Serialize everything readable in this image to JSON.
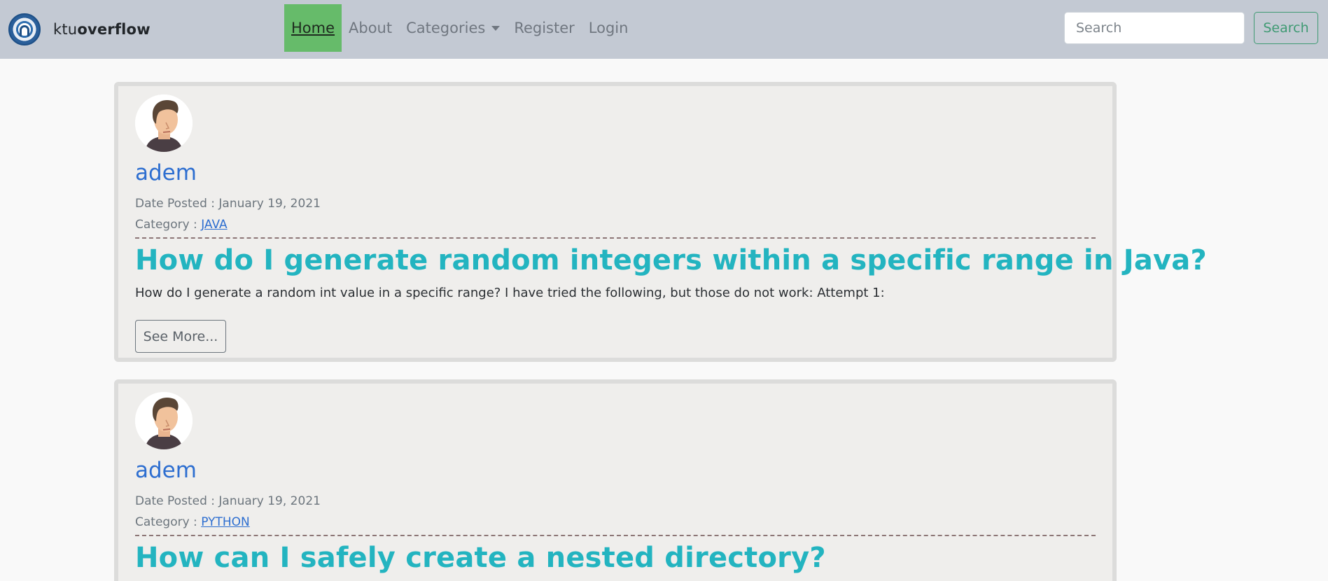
{
  "brand": {
    "prefix": "ktu",
    "suffix": "overflow"
  },
  "nav": {
    "home": "Home",
    "about": "About",
    "categories": "Categories",
    "register": "Register",
    "login": "Login"
  },
  "search": {
    "placeholder": "Search",
    "button": "Search"
  },
  "colors": {
    "navbar": "#c3c9d3",
    "active_nav": "#66bb6a",
    "title": "#23b4c0",
    "link": "#2d6ed0"
  },
  "posts": [
    {
      "author": "adem",
      "date_text": "Date Posted : January 19, 2021",
      "category_prefix": "Category : ",
      "category": "JAVA",
      "title": "How do I generate random integers within a specific range in Java?",
      "excerpt": "How do I generate a random int value in a specific range? I have tried the following, but those do not work: Attempt 1:",
      "button": "See More..."
    },
    {
      "author": "adem",
      "date_text": "Date Posted : January 19, 2021",
      "category_prefix": "Category : ",
      "category": "PYTHON",
      "title": "How can I safely create a nested directory?"
    }
  ]
}
